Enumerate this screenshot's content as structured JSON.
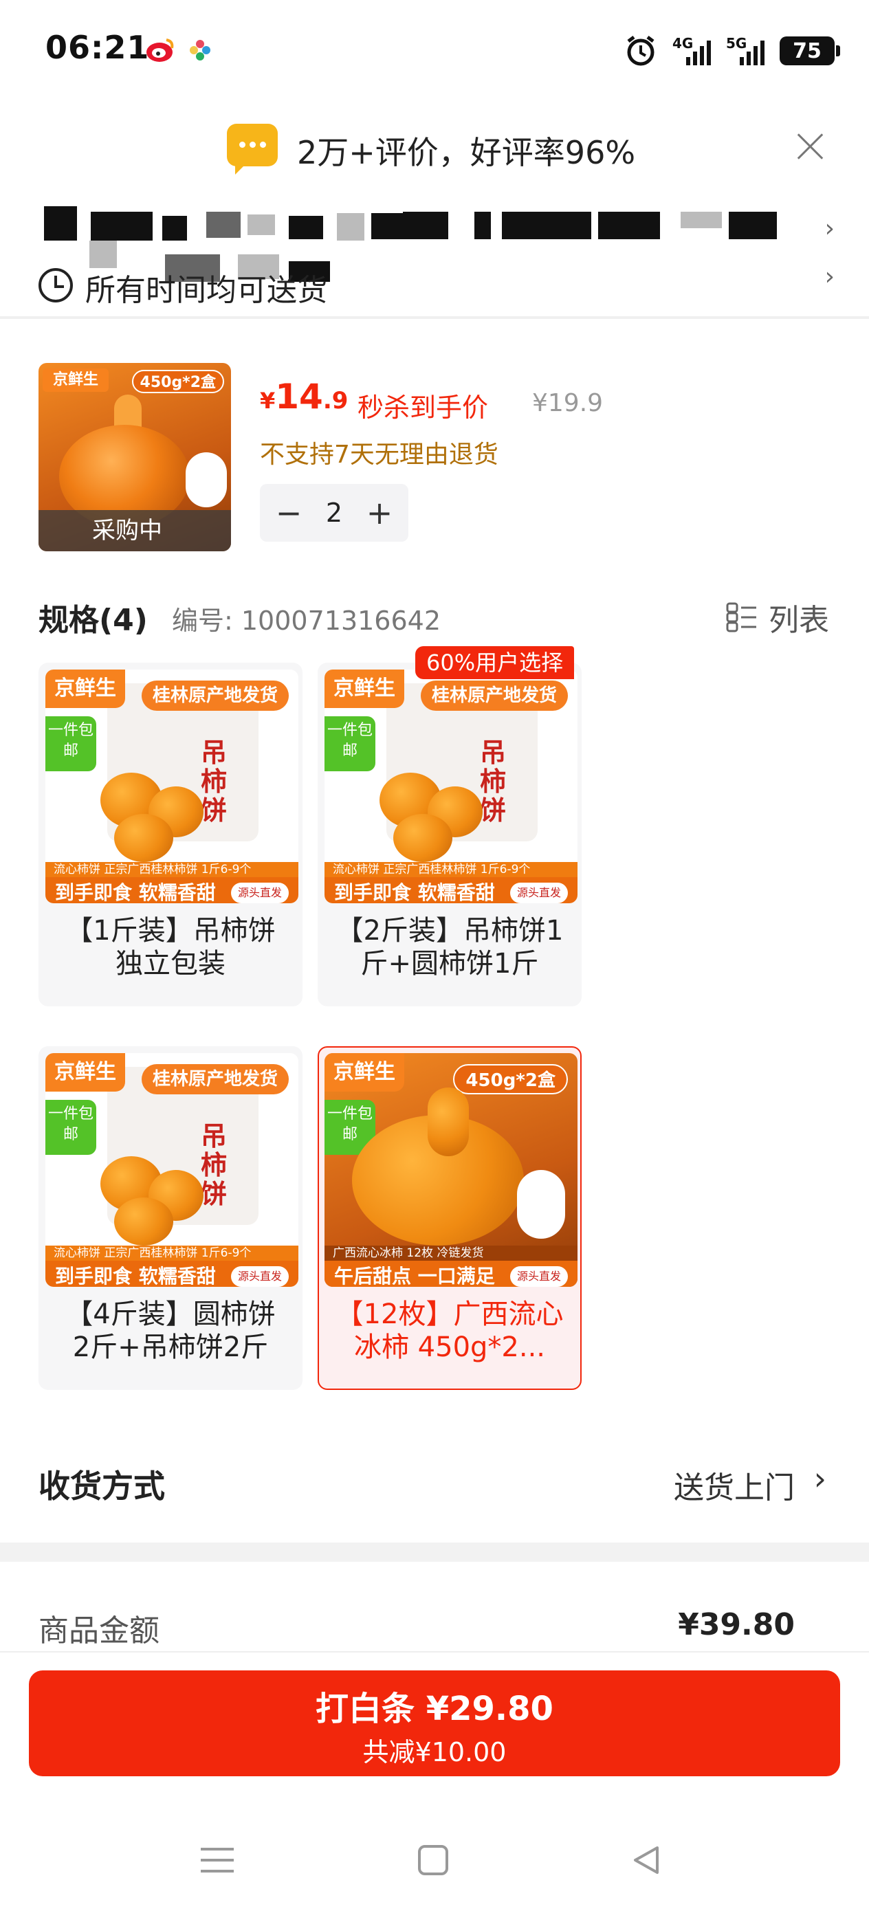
{
  "status_bar": {
    "time": "06:21",
    "network1": "4G",
    "network2": "5G",
    "battery": "75"
  },
  "review_banner": {
    "text": "2万+评价，好评率96%"
  },
  "delivery_row": {
    "text": "所有时间均可送货"
  },
  "product": {
    "thumb_brand": "京鲜生",
    "thumb_qty": "450g*2盒",
    "buying_label": "采购中",
    "price_yen": "¥",
    "price_int": "14",
    "price_dec": ".9",
    "price_label": "秒杀到手价",
    "price_original": "¥19.9",
    "return_policy": "不支持7天无理由退货",
    "quantity": "2",
    "minus": "−",
    "plus": "+"
  },
  "spec": {
    "title": "规格(4)",
    "code": "编号: 100071316642",
    "list_label": "列表",
    "hot_tag": "60%用户选择",
    "cards": [
      {
        "caption_l1": "【1斤装】吊柿饼",
        "caption_l2": "独立包装",
        "brand": "京鲜生",
        "origin": "桂林原产地发货",
        "free": "一件包邮",
        "vertical": "吊柿饼",
        "strip1": "流心柿饼  正宗广西桂林柿饼  1斤6-9个",
        "strip2": "到手即食 软糯香甜",
        "src": "源头直发"
      },
      {
        "caption_l1": "【2斤装】吊柿饼1",
        "caption_l2": "斤+圆柿饼1斤",
        "brand": "京鲜生",
        "origin": "桂林原产地发货",
        "free": "一件包邮",
        "vertical": "吊柿饼",
        "strip1": "流心柿饼  正宗广西桂林柿饼  1斤6-9个",
        "strip2": "到手即食 软糯香甜",
        "src": "源头直发"
      },
      {
        "caption_l1": "【4斤装】圆柿饼",
        "caption_l2": "2斤+吊柿饼2斤",
        "brand": "京鲜生",
        "origin": "桂林原产地发货",
        "free": "一件包邮",
        "vertical": "吊柿饼",
        "strip1": "流心柿饼  正宗广西桂林柿饼  1斤6-9个",
        "strip2": "到手即食 软糯香甜",
        "src": "源头直发"
      },
      {
        "caption_l1": "【12枚】广西流心",
        "caption_l2": "冰柿 450g*2...",
        "brand": "京鲜生",
        "origin": "450g*2盒",
        "free": "一件包邮",
        "vertical": "",
        "strip1": "广西流心冰柿  12枚  冷链发货",
        "strip2": "午后甜点 一口满足",
        "src": "源头直发"
      }
    ]
  },
  "receive": {
    "label": "收货方式",
    "value": "送货上门",
    "chevron": "›"
  },
  "amount": {
    "label": "商品金额",
    "value": "¥39.80"
  },
  "pay_button": {
    "line1": "打白条 ¥29.80",
    "line2": "共减¥10.00"
  },
  "colors": {
    "accent_red": "#f2270c",
    "brand_orange": "#f7821e",
    "warning_brown": "#b0700a"
  }
}
